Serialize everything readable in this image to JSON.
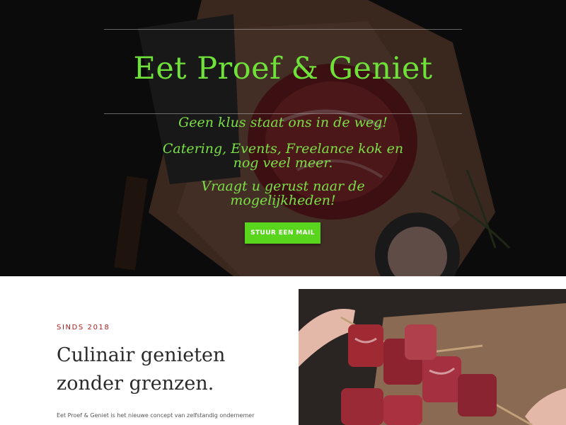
{
  "hero": {
    "title": "Eet Proef & Geniet",
    "line1": "Geen klus staat ons in de weg!",
    "line2": "Catering, Events, Freelance kok en nog veel meer.",
    "line3": "Vraagt u gerust naar de mogelijkheden!",
    "cta_label": "STUUR EEN MAIL"
  },
  "about": {
    "eyebrow": "SINDS 2018",
    "heading": "Culinair genieten zonder grenzen.",
    "intro": "Eet Proef & Geniet is het nieuwe concept van zelfstandig ondernemer"
  },
  "colors": {
    "accent_green": "#5ad51e",
    "title_green": "#6fe23a",
    "eyebrow_red": "#a81e1e"
  }
}
